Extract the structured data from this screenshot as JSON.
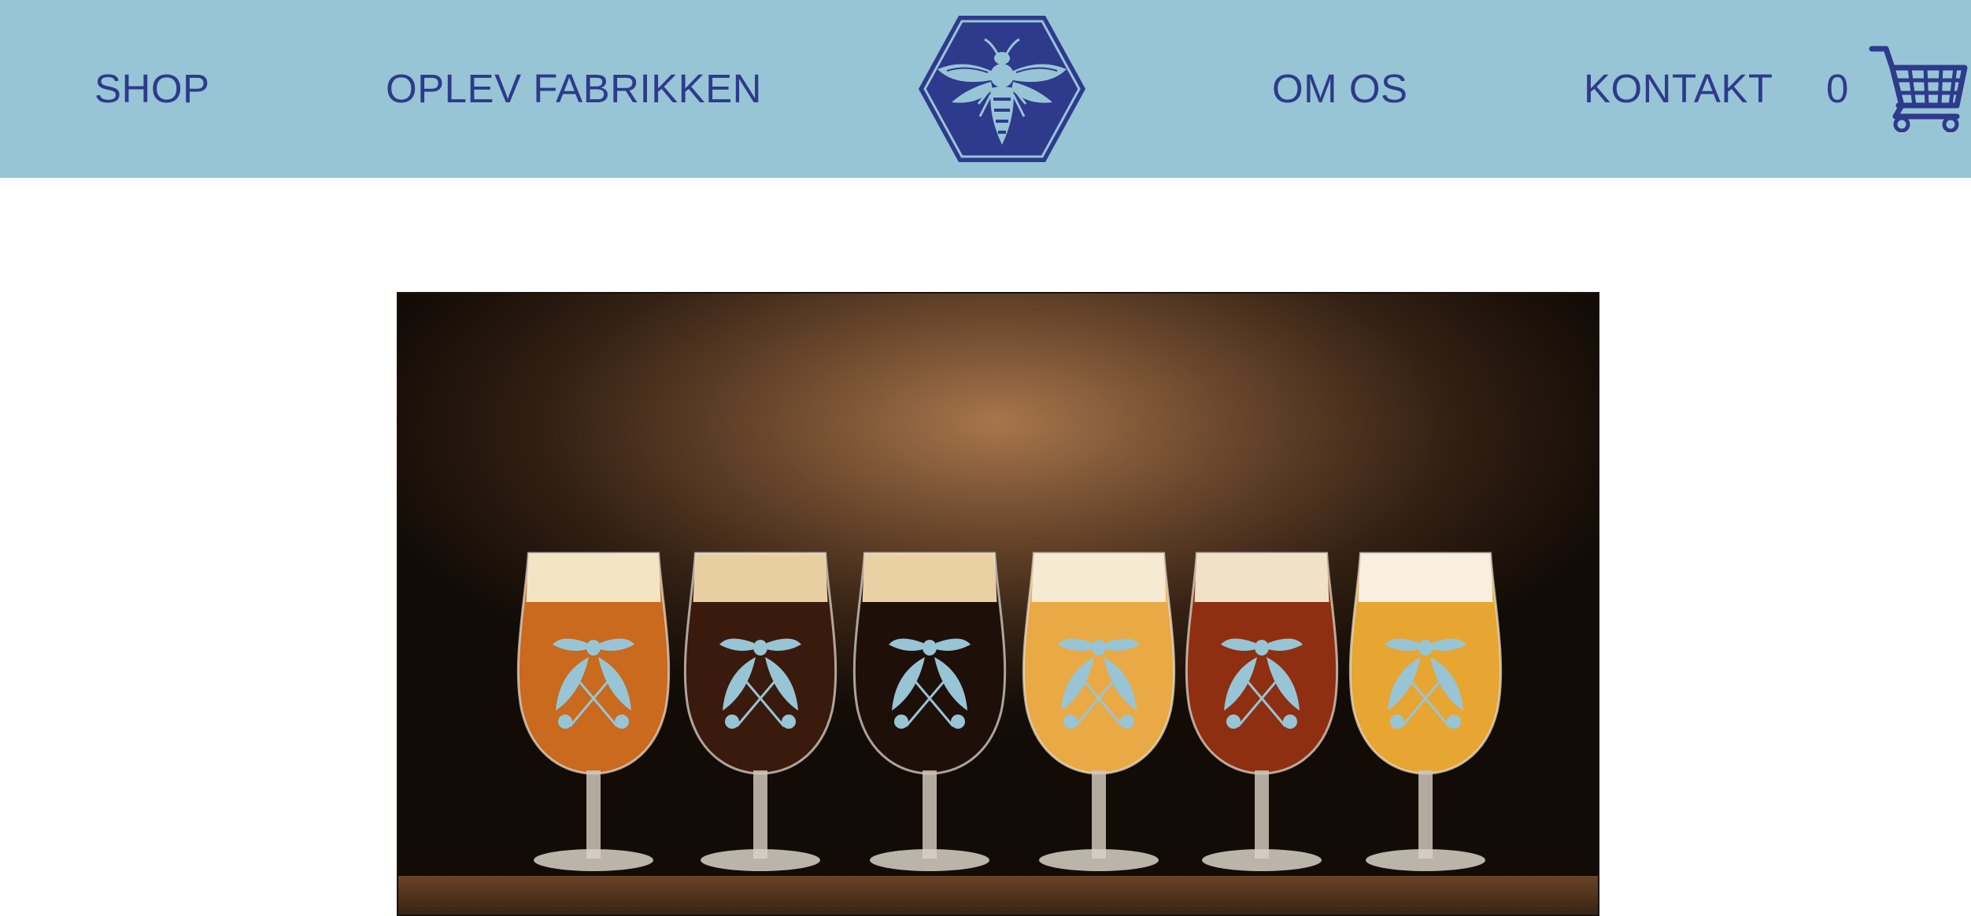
{
  "nav": {
    "shop": "SHOP",
    "oplev": "OPLEV FABRIKKEN",
    "om_os": "OM OS",
    "kontakt": "KONTAKT"
  },
  "logo": {
    "icon": "bee-hexagon-icon"
  },
  "cart": {
    "count": "0",
    "icon": "shopping-cart-icon"
  },
  "colors": {
    "header_bg": "#97c5d6",
    "nav_text": "#2e3a8c",
    "logo_fill": "#2e3a8c",
    "logo_bee": "#97c5d6"
  },
  "hero": {
    "glasses": [
      {
        "beer": "#c96a1e",
        "foam": "#f3e4c4"
      },
      {
        "beer": "#3a1a0c",
        "foam": "#e8cfa2"
      },
      {
        "beer": "#1e0f08",
        "foam": "#ead1a3"
      },
      {
        "beer": "#e9a945",
        "foam": "#f6ead2"
      },
      {
        "beer": "#8e2f12",
        "foam": "#f1e2c6"
      },
      {
        "beer": "#e7a532",
        "foam": "#f8efe0"
      }
    ]
  }
}
